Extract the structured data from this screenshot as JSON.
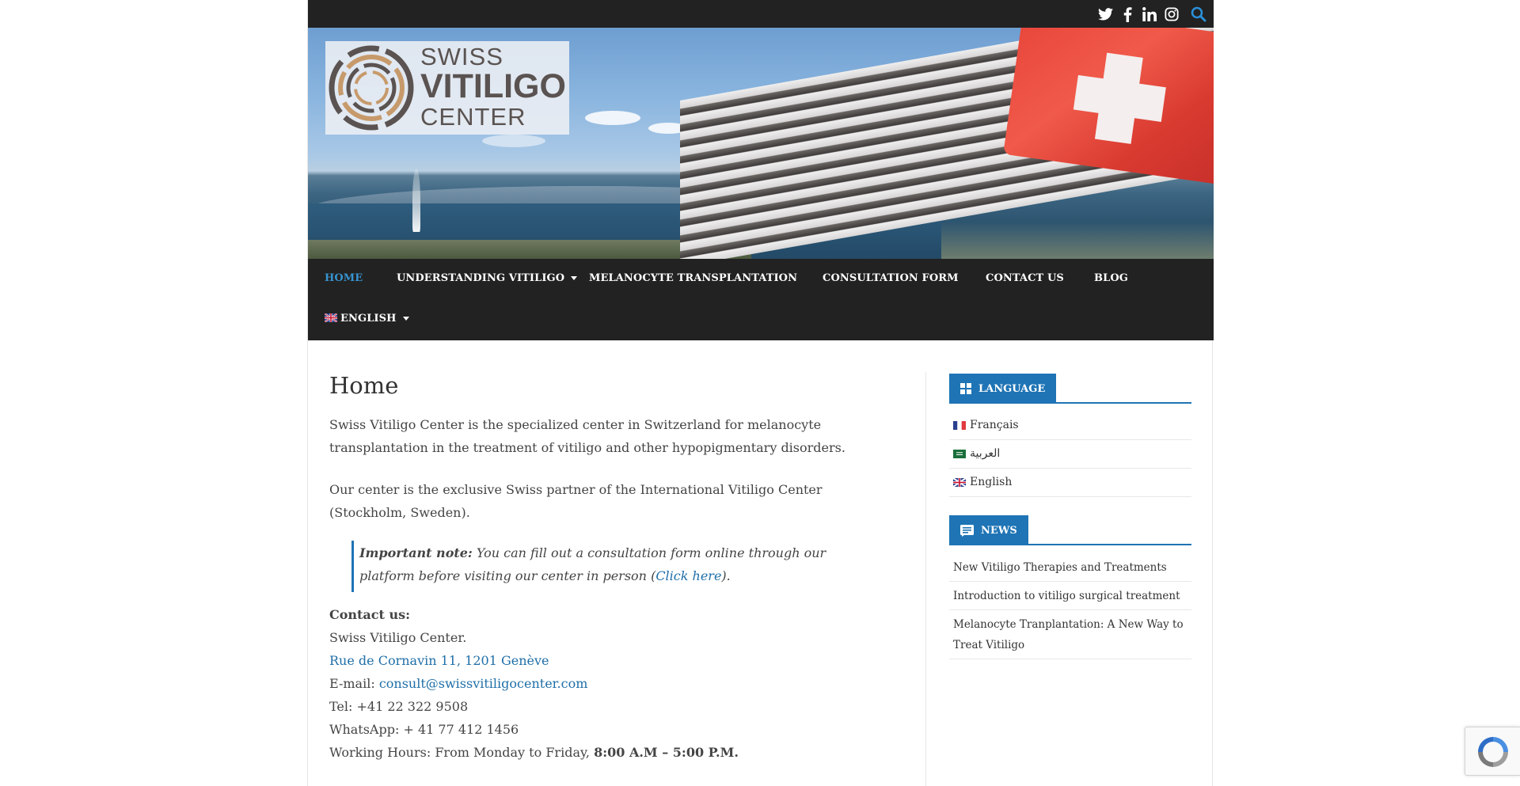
{
  "brand": {
    "line1": "SWISS",
    "line2": "VITILIGO",
    "line3": "CENTER"
  },
  "topbar": {
    "social_icons": [
      "twitter-icon",
      "facebook-icon",
      "linkedin-icon",
      "instagram-icon"
    ],
    "search_icon": "search-icon"
  },
  "nav": {
    "items": [
      {
        "label": "HOME",
        "active": true
      },
      {
        "label": "UNDERSTANDING VITILIGO",
        "dropdown": true
      },
      {
        "label": "MELANOCYTE TRANSPLANTATION"
      },
      {
        "label": "CONSULTATION FORM"
      },
      {
        "label": "CONTACT US"
      },
      {
        "label": "BLOG"
      },
      {
        "label": "ENGLISH",
        "dropdown": true
      }
    ]
  },
  "main": {
    "title": "Home",
    "para1": "Swiss Vitiligo Center is the specialized center in Switzerland for melanocyte transplantation in the treatment of vitiligo and other hypopigmentary disorders.",
    "para2": "Our center is the exclusive Swiss partner of the International Vitiligo Center (Stockholm, Sweden).",
    "note": {
      "label": "Important note:",
      "text": " You can fill out a consultation form online through our platform before visiting our center in person (",
      "link": "Click here",
      "end": ")."
    },
    "contact": {
      "header": "Contact us:",
      "name": "Swiss Vitiligo Center.",
      "address": "Rue de Cornavin 11, 1201 Genève",
      "email_label": "E-mail: ",
      "email": "consult@swissvitiligocenter.com",
      "tel": "Tel: +41 22 322 9508",
      "whatsapp": "WhatsApp: + 41 77 412 1456",
      "hours_label": "Working Hours: From Monday to Friday, ",
      "hours": "8:00 A.M – 5:00 P.M."
    }
  },
  "sidebar": {
    "language": {
      "title": "LANGUAGE",
      "items": [
        "Français",
        "العربية",
        "English"
      ]
    },
    "news": {
      "title": "NEWS",
      "items": [
        "New Vitiligo Therapies and Treatments",
        "Introduction to vitiligo surgical treatment",
        "Melanocyte Tranplantation: A New Way to Treat Vitiligo"
      ]
    }
  },
  "colors": {
    "accent": "#1e74b5",
    "nav_bg": "#222222",
    "link": "#1f6fa8"
  }
}
